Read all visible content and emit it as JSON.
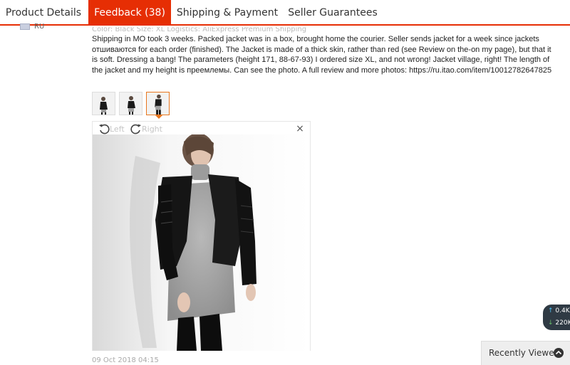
{
  "tabs": [
    {
      "label": "Product Details"
    },
    {
      "label": "Feedback (38)"
    },
    {
      "label": "Shipping & Payment"
    },
    {
      "label": "Seller Guarantees"
    }
  ],
  "review": {
    "country": "RU",
    "meta": "Color: Black    Size: XL    Logistics: AliExpress Premium Shipping",
    "text": "Shipping in MO took 3 weeks. Packed jacket was in a box, brought home the courier. Seller sends jacket for a week since jackets отшиваются for each order (finished). The Jacket is made of a thick skin, rather than red (see Review on the-on my page), but that it is soft. Dressing a bang! The parameters (height 171, 88-67-93) I ordered size XL, and not wrong! Jacket village, right! The length of the jacket and my height is преемлемы. Can see the photo. A full review and more photos: https://ru.itao.com/item/10012782647825",
    "date": "09 Oct 2018 04:15"
  },
  "viewer": {
    "rotate_left_label": "Left",
    "rotate_right_label": "Right",
    "close_symbol": "×",
    "thumbnail_count": 3,
    "selected_thumbnail": 3
  },
  "speed_widget": {
    "up": "0.4K",
    "down": "220K"
  },
  "recently_viewed": {
    "label": "Recently Viewed"
  },
  "colors": {
    "accent": "#e62e04",
    "thumb_selected": "#e8761e"
  },
  "icons": {
    "rotate_left": "rotate-left-icon",
    "rotate_right": "rotate-right-icon",
    "close": "close-icon",
    "flag": "flag-icon",
    "chevron_up": "chevron-up-icon"
  }
}
